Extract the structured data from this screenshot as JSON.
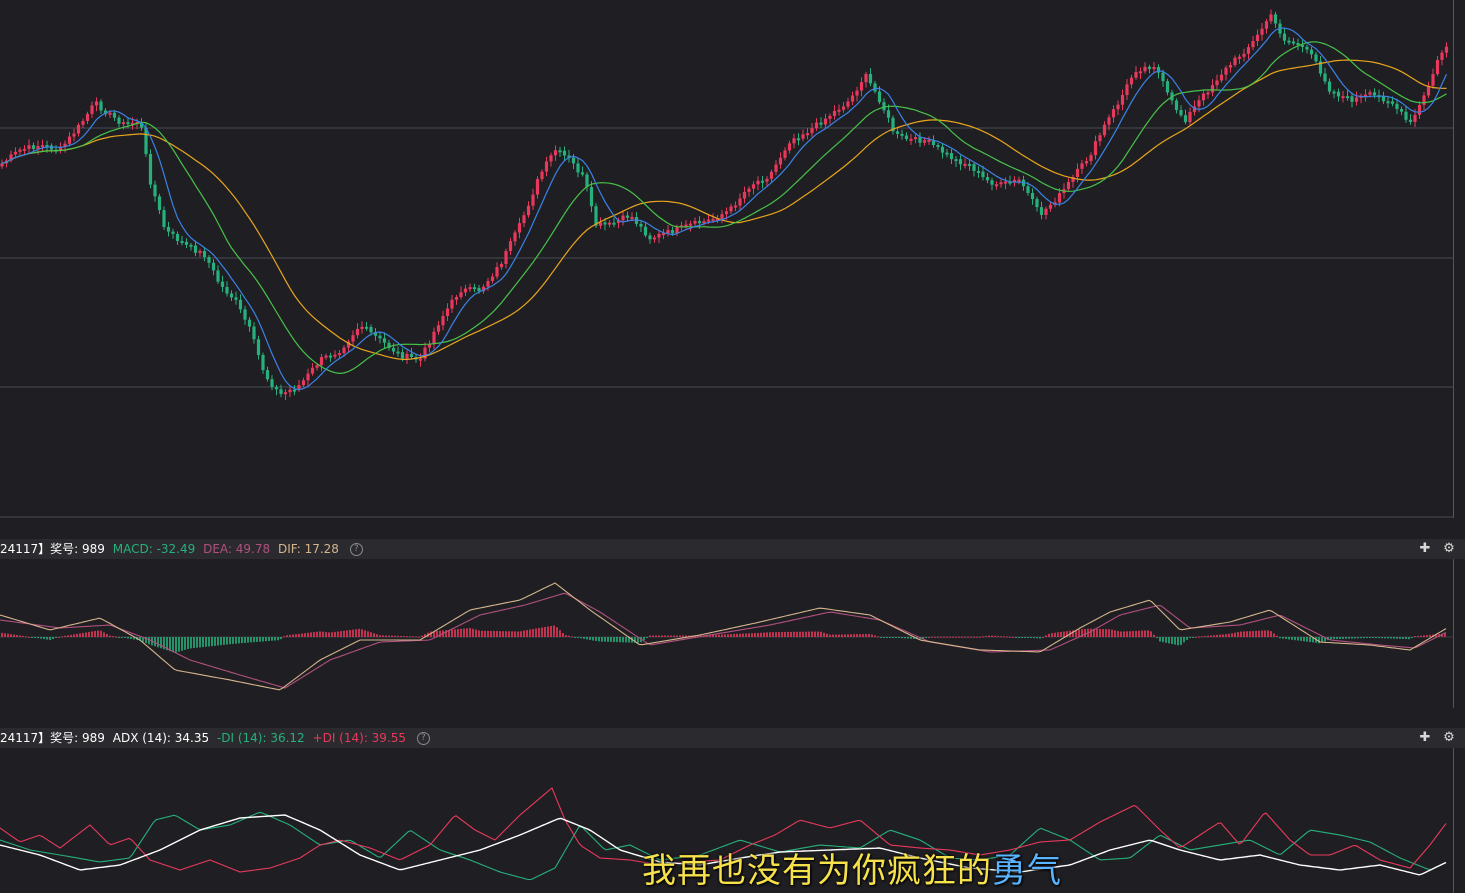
{
  "colors": {
    "background": "#1f1f23",
    "header_bg": "#2b2b2f",
    "grid": "#4a4b50",
    "up_candle": "#e8395c",
    "down_candle": "#27b07b",
    "ma_short": "#3b82e6",
    "ma_mid": "#47c24a",
    "ma_long": "#e8a51c",
    "macd_dif": "#d4b48c",
    "macd_dea": "#b0507e",
    "adx": "#ffffff",
    "minus_di": "#27b07b",
    "plus_di": "#e8395c",
    "subtitle_text": "#f7e14a",
    "subtitle_highlight": "#5ab3ff"
  },
  "macd_header": {
    "prefix": "24117】奖号: 989",
    "macd": "MACD: -32.49",
    "dea": "DEA: 49.78",
    "dif": "DIF: 17.28",
    "help": "?"
  },
  "adx_header": {
    "prefix": "24117】奖号: 989",
    "adx": "ADX (14): 34.35",
    "minus_di": "-DI (14): 36.12",
    "plus_di": "+DI (14): 39.55",
    "help": "?"
  },
  "icons": {
    "pin": "pin-icon",
    "settings": "gear-icon",
    "help": "help-icon"
  },
  "subtitle": {
    "text": "我再也没有为你疯狂的",
    "highlight": "勇气"
  },
  "chart_data": [
    {
      "type": "candlestick",
      "name": "price",
      "ma_series": [
        "short",
        "mid",
        "long"
      ],
      "path_points": [
        [
          0,
          165
        ],
        [
          20,
          150
        ],
        [
          40,
          145
        ],
        [
          60,
          150
        ],
        [
          80,
          125
        ],
        [
          95,
          103
        ],
        [
          110,
          115
        ],
        [
          125,
          125
        ],
        [
          140,
          120
        ],
        [
          150,
          180
        ],
        [
          165,
          230
        ],
        [
          185,
          245
        ],
        [
          205,
          255
        ],
        [
          220,
          285
        ],
        [
          235,
          300
        ],
        [
          250,
          330
        ],
        [
          265,
          375
        ],
        [
          280,
          395
        ],
        [
          300,
          385
        ],
        [
          320,
          360
        ],
        [
          340,
          350
        ],
        [
          360,
          325
        ],
        [
          380,
          340
        ],
        [
          400,
          355
        ],
        [
          420,
          360
        ],
        [
          440,
          320
        ],
        [
          460,
          290
        ],
        [
          480,
          290
        ],
        [
          500,
          265
        ],
        [
          520,
          225
        ],
        [
          540,
          175
        ],
        [
          555,
          150
        ],
        [
          570,
          160
        ],
        [
          585,
          180
        ],
        [
          595,
          225
        ],
        [
          610,
          225
        ],
        [
          630,
          215
        ],
        [
          650,
          238
        ],
        [
          670,
          232
        ],
        [
          690,
          225
        ],
        [
          710,
          220
        ],
        [
          730,
          210
        ],
        [
          750,
          185
        ],
        [
          770,
          175
        ],
        [
          790,
          140
        ],
        [
          810,
          130
        ],
        [
          830,
          115
        ],
        [
          850,
          100
        ],
        [
          865,
          75
        ],
        [
          880,
          100
        ],
        [
          895,
          135
        ],
        [
          910,
          140
        ],
        [
          925,
          140
        ],
        [
          940,
          150
        ],
        [
          955,
          160
        ],
        [
          970,
          165
        ],
        [
          985,
          180
        ],
        [
          1000,
          185
        ],
        [
          1020,
          180
        ],
        [
          1040,
          215
        ],
        [
          1060,
          195
        ],
        [
          1075,
          175
        ],
        [
          1090,
          155
        ],
        [
          1105,
          125
        ],
        [
          1120,
          100
        ],
        [
          1135,
          70
        ],
        [
          1155,
          65
        ],
        [
          1170,
          100
        ],
        [
          1185,
          120
        ],
        [
          1200,
          100
        ],
        [
          1220,
          75
        ],
        [
          1240,
          55
        ],
        [
          1255,
          40
        ],
        [
          1270,
          15
        ],
        [
          1285,
          40
        ],
        [
          1300,
          45
        ],
        [
          1315,
          60
        ],
        [
          1330,
          90
        ],
        [
          1350,
          100
        ],
        [
          1370,
          95
        ],
        [
          1390,
          100
        ],
        [
          1410,
          125
        ],
        [
          1425,
          95
        ],
        [
          1440,
          55
        ],
        [
          1447,
          45
        ]
      ]
    },
    {
      "type": "line+bar",
      "name": "MACD",
      "series": [
        {
          "name": "DIF",
          "values": [
            17.28
          ]
        },
        {
          "name": "DEA",
          "values": [
            49.78
          ]
        },
        {
          "name": "MACD",
          "values": [
            -32.49
          ]
        }
      ],
      "dif_path": [
        [
          0,
          615
        ],
        [
          50,
          630
        ],
        [
          100,
          618
        ],
        [
          140,
          640
        ],
        [
          175,
          670
        ],
        [
          230,
          680
        ],
        [
          280,
          690
        ],
        [
          320,
          660
        ],
        [
          360,
          640
        ],
        [
          420,
          640
        ],
        [
          470,
          610
        ],
        [
          520,
          600
        ],
        [
          555,
          583
        ],
        [
          590,
          610
        ],
        [
          640,
          645
        ],
        [
          700,
          635
        ],
        [
          760,
          622
        ],
        [
          820,
          608
        ],
        [
          870,
          615
        ],
        [
          920,
          640
        ],
        [
          980,
          650
        ],
        [
          1040,
          652
        ],
        [
          1080,
          628
        ],
        [
          1110,
          612
        ],
        [
          1150,
          600
        ],
        [
          1180,
          630
        ],
        [
          1230,
          622
        ],
        [
          1270,
          610
        ],
        [
          1320,
          642
        ],
        [
          1370,
          645
        ],
        [
          1410,
          650
        ],
        [
          1447,
          628
        ]
      ],
      "dea_path": [
        [
          0,
          620
        ],
        [
          60,
          628
        ],
        [
          110,
          625
        ],
        [
          150,
          640
        ],
        [
          190,
          660
        ],
        [
          240,
          675
        ],
        [
          285,
          688
        ],
        [
          330,
          660
        ],
        [
          380,
          642
        ],
        [
          430,
          640
        ],
        [
          480,
          615
        ],
        [
          525,
          605
        ],
        [
          565,
          593
        ],
        [
          600,
          612
        ],
        [
          650,
          645
        ],
        [
          710,
          635
        ],
        [
          770,
          625
        ],
        [
          830,
          612
        ],
        [
          880,
          620
        ],
        [
          930,
          642
        ],
        [
          990,
          652
        ],
        [
          1050,
          650
        ],
        [
          1090,
          632
        ],
        [
          1120,
          615
        ],
        [
          1160,
          605
        ],
        [
          1190,
          628
        ],
        [
          1240,
          625
        ],
        [
          1280,
          615
        ],
        [
          1330,
          640
        ],
        [
          1380,
          645
        ],
        [
          1415,
          648
        ],
        [
          1447,
          632
        ]
      ]
    },
    {
      "type": "line",
      "name": "ADX",
      "adx_path": [
        [
          0,
          845
        ],
        [
          40,
          855
        ],
        [
          80,
          870
        ],
        [
          120,
          865
        ],
        [
          160,
          850
        ],
        [
          200,
          830
        ],
        [
          240,
          818
        ],
        [
          285,
          815
        ],
        [
          320,
          830
        ],
        [
          360,
          855
        ],
        [
          400,
          870
        ],
        [
          440,
          860
        ],
        [
          480,
          850
        ],
        [
          520,
          835
        ],
        [
          560,
          818
        ],
        [
          590,
          830
        ],
        [
          620,
          850
        ],
        [
          660,
          862
        ],
        [
          700,
          865
        ],
        [
          740,
          858
        ],
        [
          780,
          852
        ],
        [
          830,
          850
        ],
        [
          880,
          848
        ],
        [
          920,
          858
        ],
        [
          970,
          868
        ],
        [
          1020,
          872
        ],
        [
          1070,
          865
        ],
        [
          1110,
          850
        ],
        [
          1150,
          840
        ],
        [
          1180,
          850
        ],
        [
          1220,
          860
        ],
        [
          1260,
          855
        ],
        [
          1300,
          865
        ],
        [
          1340,
          870
        ],
        [
          1380,
          865
        ],
        [
          1420,
          875
        ],
        [
          1447,
          862
        ]
      ],
      "minus_di_path": [
        [
          0,
          840
        ],
        [
          30,
          850
        ],
        [
          60,
          855
        ],
        [
          100,
          862
        ],
        [
          130,
          858
        ],
        [
          155,
          820
        ],
        [
          175,
          815
        ],
        [
          200,
          830
        ],
        [
          230,
          825
        ],
        [
          260,
          812
        ],
        [
          290,
          825
        ],
        [
          320,
          845
        ],
        [
          350,
          840
        ],
        [
          380,
          858
        ],
        [
          410,
          830
        ],
        [
          440,
          850
        ],
        [
          470,
          860
        ],
        [
          500,
          872
        ],
        [
          530,
          880
        ],
        [
          555,
          868
        ],
        [
          580,
          825
        ],
        [
          605,
          850
        ],
        [
          630,
          845
        ],
        [
          660,
          860
        ],
        [
          700,
          855
        ],
        [
          740,
          840
        ],
        [
          780,
          852
        ],
        [
          820,
          845
        ],
        [
          860,
          848
        ],
        [
          890,
          830
        ],
        [
          920,
          840
        ],
        [
          950,
          858
        ],
        [
          980,
          860
        ],
        [
          1010,
          855
        ],
        [
          1040,
          828
        ],
        [
          1070,
          840
        ],
        [
          1100,
          860
        ],
        [
          1130,
          858
        ],
        [
          1160,
          835
        ],
        [
          1190,
          850
        ],
        [
          1220,
          845
        ],
        [
          1250,
          840
        ],
        [
          1280,
          855
        ],
        [
          1310,
          830
        ],
        [
          1340,
          835
        ],
        [
          1370,
          842
        ],
        [
          1400,
          858
        ],
        [
          1430,
          870
        ],
        [
          1447,
          862
        ]
      ],
      "plus_di_path": [
        [
          0,
          828
        ],
        [
          20,
          842
        ],
        [
          40,
          835
        ],
        [
          60,
          848
        ],
        [
          90,
          825
        ],
        [
          110,
          845
        ],
        [
          130,
          838
        ],
        [
          150,
          860
        ],
        [
          180,
          870
        ],
        [
          210,
          860
        ],
        [
          240,
          872
        ],
        [
          270,
          868
        ],
        [
          300,
          858
        ],
        [
          320,
          845
        ],
        [
          340,
          840
        ],
        [
          370,
          848
        ],
        [
          400,
          860
        ],
        [
          430,
          845
        ],
        [
          455,
          815
        ],
        [
          475,
          830
        ],
        [
          495,
          840
        ],
        [
          520,
          815
        ],
        [
          552,
          788
        ],
        [
          565,
          820
        ],
        [
          580,
          845
        ],
        [
          600,
          858
        ],
        [
          630,
          860
        ],
        [
          660,
          865
        ],
        [
          690,
          862
        ],
        [
          720,
          860
        ],
        [
          750,
          845
        ],
        [
          775,
          835
        ],
        [
          800,
          820
        ],
        [
          830,
          828
        ],
        [
          860,
          820
        ],
        [
          890,
          845
        ],
        [
          920,
          848
        ],
        [
          950,
          850
        ],
        [
          980,
          855
        ],
        [
          1010,
          850
        ],
        [
          1040,
          842
        ],
        [
          1070,
          840
        ],
        [
          1100,
          822
        ],
        [
          1135,
          805
        ],
        [
          1160,
          830
        ],
        [
          1180,
          848
        ],
        [
          1200,
          835
        ],
        [
          1220,
          822
        ],
        [
          1240,
          845
        ],
        [
          1265,
          812
        ],
        [
          1290,
          840
        ],
        [
          1310,
          855
        ],
        [
          1330,
          855
        ],
        [
          1355,
          845
        ],
        [
          1380,
          860
        ],
        [
          1410,
          868
        ],
        [
          1430,
          845
        ],
        [
          1447,
          822
        ]
      ]
    }
  ]
}
